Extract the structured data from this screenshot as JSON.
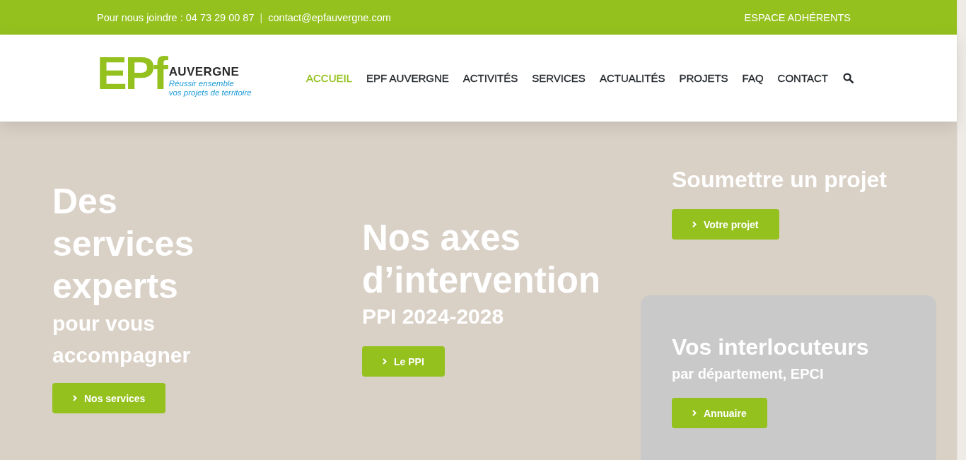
{
  "top_bar": {
    "contact_text": "Pour nous joindre : 04 73 29 00 87",
    "separator": "|",
    "email": "contact@epfauvergne.com",
    "member_link": "ESPACE ADHÉRENTS"
  },
  "header": {
    "logo": {
      "mark": "EPf",
      "name": "AUVERGNE",
      "tagline": [
        "Réussir ensemble",
        "vos projets de territoire"
      ]
    },
    "nav": [
      {
        "label": "ACCUEIL",
        "selected": true
      },
      {
        "label": "EPF AUVERGNE",
        "selected": false
      },
      {
        "label": "ACTIVITÉS",
        "selected": false
      },
      {
        "label": "SERVICES",
        "selected": false
      },
      {
        "label": "ACTUALITÉS",
        "selected": false
      },
      {
        "label": "PROJETS",
        "selected": false
      },
      {
        "label": "FAQ",
        "selected": false
      },
      {
        "label": "CONTACT",
        "selected": false
      }
    ]
  },
  "hero": {
    "columns": [
      {
        "blocks": [
          {
            "kind": "plain",
            "title": "Des services experts",
            "subtitle": "pour vous accompagner",
            "button": "Nos services"
          }
        ]
      },
      {
        "blocks": [
          {
            "kind": "plain",
            "title": "Nos axes d’intervention",
            "subtitle": "PPI 2024-2028",
            "button": "Le PPI"
          }
        ]
      },
      {
        "blocks": [
          {
            "kind": "plain",
            "title": "Soumettre un projet",
            "button": "Votre projet"
          },
          {
            "kind": "card",
            "title": "Vos interlocuteurs",
            "subtitle": "par département, EPCI",
            "button": "Annuaire"
          }
        ]
      }
    ]
  }
}
